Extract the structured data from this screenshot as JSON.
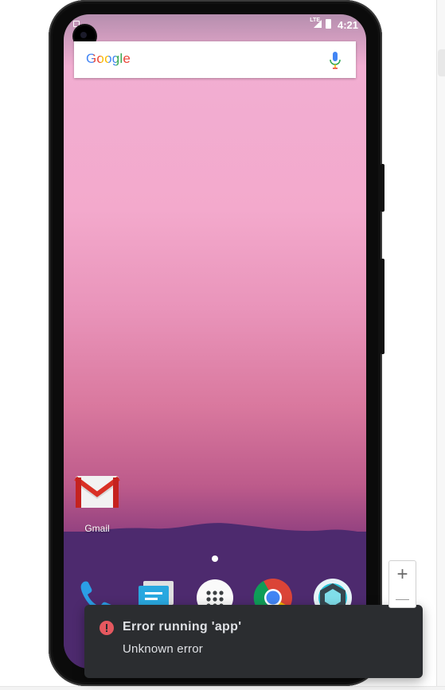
{
  "status_bar": {
    "time": "4:21",
    "network": "LTE"
  },
  "search": {
    "logo_text": "Google",
    "mic_icon": "mic-icon"
  },
  "apps": [
    {
      "label": "Gmail",
      "icon": "gmail-icon"
    }
  ],
  "dock": [
    {
      "icon": "phone-icon"
    },
    {
      "icon": "messages-icon"
    },
    {
      "icon": "app-drawer-icon"
    },
    {
      "icon": "chrome-icon"
    },
    {
      "icon": "camera-icon"
    }
  ],
  "notification": {
    "title": "Error running 'app'",
    "message": "Unknown error",
    "icon": "error-icon",
    "accent_color": "#e5585f"
  },
  "zoom_controls": {
    "zoom_in_label": "+"
  }
}
